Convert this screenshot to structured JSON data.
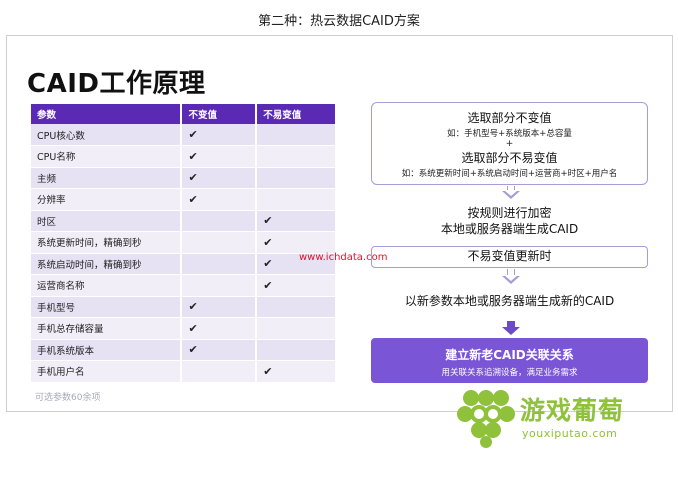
{
  "caption": "第二种：热云数据CAID方案",
  "slide": {
    "title": "CAID工作原理",
    "table": {
      "headers": [
        "参数",
        "不变值",
        "不易变值"
      ],
      "rows": [
        {
          "param": "CPU核心数",
          "invariant": "✔",
          "stable": ""
        },
        {
          "param": "CPU名称",
          "invariant": "✔",
          "stable": ""
        },
        {
          "param": "主频",
          "invariant": "✔",
          "stable": ""
        },
        {
          "param": "分辨率",
          "invariant": "✔",
          "stable": ""
        },
        {
          "param": "时区",
          "invariant": "",
          "stable": "✔"
        },
        {
          "param": "系统更新时间，精确到秒",
          "invariant": "",
          "stable": "✔"
        },
        {
          "param": "系统启动时间，精确到秒",
          "invariant": "",
          "stable": "✔"
        },
        {
          "param": "运营商名称",
          "invariant": "",
          "stable": "✔"
        },
        {
          "param": "手机型号",
          "invariant": "✔",
          "stable": ""
        },
        {
          "param": "手机总存储容量",
          "invariant": "✔",
          "stable": ""
        },
        {
          "param": "手机系统版本",
          "invariant": "✔",
          "stable": ""
        },
        {
          "param": "手机用户名",
          "invariant": "",
          "stable": "✔"
        }
      ]
    },
    "footnote": "可选参数60余项",
    "flow": {
      "box1_line1": "选取部分不变值",
      "box1_line2": "如：手机型号+系统版本+总容量",
      "box1_plus": "+",
      "box1_line3": "选取部分不易变值",
      "box1_line4": "如：系统更新时间+系统启动时间+运营商+时区+用户名",
      "step2_line1": "按规则进行加密",
      "step2_line2": "本地或服务器端生成CAID",
      "box2": "不易变值更新时",
      "step3": "以新参数本地或服务器端生成新的CAID",
      "result_title": "建立新老CAID关联关系",
      "result_sub": "用关联关系追溯设备，满足业务需求"
    },
    "watermark": "www.ichdata.com"
  },
  "logo": {
    "name": "游戏葡萄",
    "url_text": "youxiputao.com",
    "color": "#8fc13a"
  },
  "colors": {
    "header_purple": "#5b2ab4",
    "check_magenta": "#c21bc6",
    "result_purple": "#7a55d6",
    "box_border": "#a89bd8"
  }
}
